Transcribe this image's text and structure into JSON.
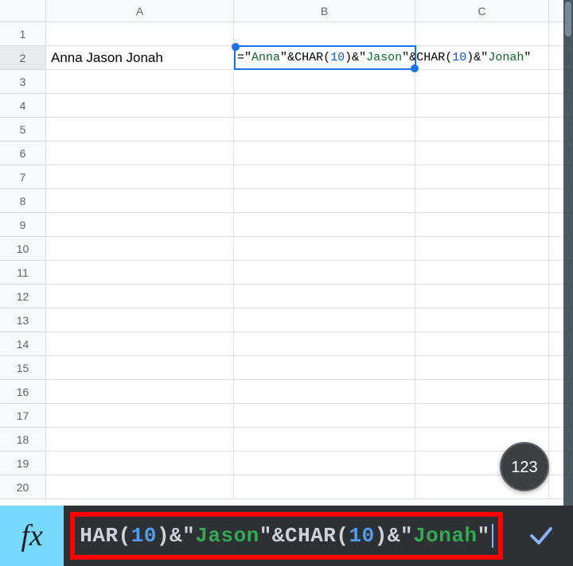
{
  "columns": {
    "A": "A",
    "B": "B",
    "C": "C",
    "D": ""
  },
  "row_count": 20,
  "active_cell": "B2",
  "cells": {
    "A2": "Anna Jason Jonah"
  },
  "formula_tokens_inline": [
    {
      "t": "op",
      "v": "="
    },
    {
      "t": "op",
      "v": "\""
    },
    {
      "t": "str",
      "v": "Anna"
    },
    {
      "t": "op",
      "v": "\""
    },
    {
      "t": "op",
      "v": "&"
    },
    {
      "t": "fn",
      "v": "CHAR"
    },
    {
      "t": "op",
      "v": "("
    },
    {
      "t": "num",
      "v": "10"
    },
    {
      "t": "op",
      "v": ")"
    },
    {
      "t": "op",
      "v": "&"
    },
    {
      "t": "op",
      "v": "\""
    },
    {
      "t": "str",
      "v": "Jason"
    },
    {
      "t": "op",
      "v": "\""
    },
    {
      "t": "op",
      "v": "&"
    },
    {
      "t": "fn",
      "v": "CHAR"
    },
    {
      "t": "op",
      "v": "("
    },
    {
      "t": "num",
      "v": "10"
    },
    {
      "t": "op",
      "v": ")"
    },
    {
      "t": "op",
      "v": "&"
    },
    {
      "t": "op",
      "v": "\""
    },
    {
      "t": "str",
      "v": "Jonah"
    },
    {
      "t": "op",
      "v": "\""
    }
  ],
  "formula_tokens_bar": [
    {
      "t": "fn",
      "v": "HAR"
    },
    {
      "t": "paren",
      "v": "("
    },
    {
      "t": "num",
      "v": "10"
    },
    {
      "t": "paren",
      "v": ")"
    },
    {
      "t": "op",
      "v": "&"
    },
    {
      "t": "op",
      "v": "\""
    },
    {
      "t": "str",
      "v": "Jason"
    },
    {
      "t": "op",
      "v": "\""
    },
    {
      "t": "op",
      "v": "&"
    },
    {
      "t": "fn",
      "v": "CHAR"
    },
    {
      "t": "paren",
      "v": "("
    },
    {
      "t": "num",
      "v": "10"
    },
    {
      "t": "paren",
      "v": ")"
    },
    {
      "t": "op",
      "v": "&"
    },
    {
      "t": "op",
      "v": "\""
    },
    {
      "t": "str",
      "v": "Jonah"
    },
    {
      "t": "op",
      "v": "\""
    }
  ],
  "num_toggle_label": "123",
  "fx_label": "fx",
  "colors": {
    "selection": "#1a73e8",
    "string": "#0d652d",
    "number": "#1155cc",
    "bar_bg": "#2d3134",
    "fx_bg": "#78d9ff",
    "highlight_border": "#ff0000"
  }
}
